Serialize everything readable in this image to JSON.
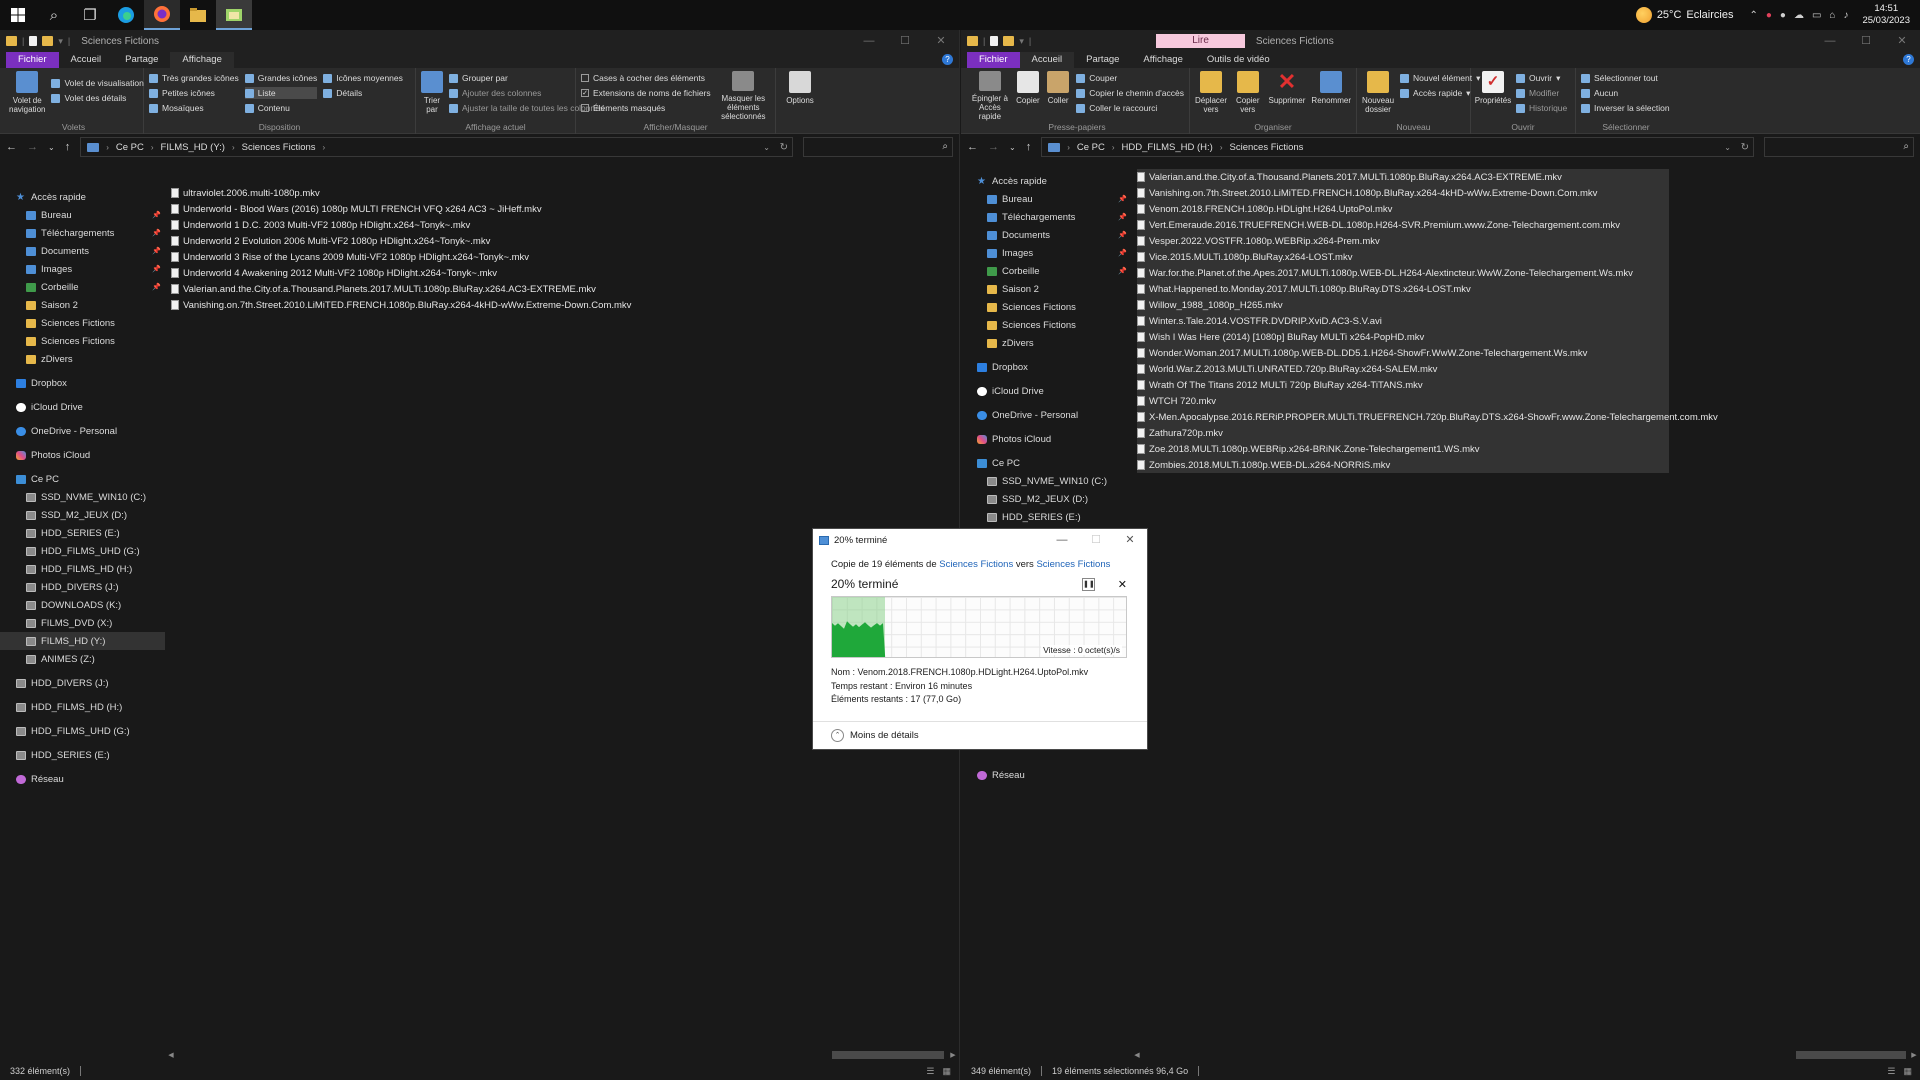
{
  "taskbar": {
    "weather_temp": "25°C",
    "weather_text": "Eclaircies",
    "time": "14:51",
    "date": "25/03/2023"
  },
  "left": {
    "title": "Sciences Fictions",
    "tabs": [
      "Fichier",
      "Accueil",
      "Partage",
      "Affichage"
    ],
    "ribbon": {
      "volets": {
        "label": "Volets",
        "nav_pane": "Volet de navigation",
        "preview": "Volet de visualisation",
        "details": "Volet des détails"
      },
      "disposition": {
        "label": "Disposition",
        "items": [
          "Très grandes icônes",
          "Grandes icônes",
          "Icônes moyennes",
          "Petites icônes",
          "Liste",
          "Détails",
          "Mosaïques",
          "Contenu"
        ]
      },
      "affichage_actuel": {
        "label": "Affichage actuel",
        "sort": "Trier par",
        "group": "Grouper par",
        "add_cols": "Ajouter des colonnes",
        "fit_cols": "Ajuster la taille de toutes les colonnes"
      },
      "afficher": {
        "label": "Afficher/Masquer",
        "checkboxes": "Cases à cocher des éléments",
        "extensions": "Extensions de noms de fichiers",
        "hidden": "Éléments masqués",
        "hide_selected": "Masquer les éléments sélectionnés"
      },
      "options": "Options"
    },
    "breadcrumb": [
      "Ce PC",
      "FILMS_HD (Y:)",
      "Sciences Fictions"
    ],
    "nav": [
      {
        "label": "Accès rapide",
        "type": "star",
        "indent": 0
      },
      {
        "label": "Bureau",
        "type": "folder-blue",
        "indent": 1,
        "pin": true
      },
      {
        "label": "Téléchargements",
        "type": "folder-blue",
        "indent": 1,
        "pin": true
      },
      {
        "label": "Documents",
        "type": "folder-blue",
        "indent": 1,
        "pin": true
      },
      {
        "label": "Images",
        "type": "folder-blue",
        "indent": 1,
        "pin": true
      },
      {
        "label": "Corbeille",
        "type": "green",
        "indent": 1,
        "pin": true
      },
      {
        "label": "Saison 2",
        "type": "folder",
        "indent": 1
      },
      {
        "label": "Sciences Fictions",
        "type": "folder",
        "indent": 1
      },
      {
        "label": "Sciences Fictions",
        "type": "folder",
        "indent": 1
      },
      {
        "label": "zDivers",
        "type": "folder",
        "indent": 1
      },
      {
        "label": "Dropbox",
        "type": "dropbox",
        "indent": 0,
        "gap": true
      },
      {
        "label": "iCloud Drive",
        "type": "cloud",
        "indent": 0,
        "gap": true
      },
      {
        "label": "OneDrive - Personal",
        "type": "onedrive",
        "indent": 0,
        "gap": true
      },
      {
        "label": "Photos iCloud",
        "type": "photos",
        "indent": 0,
        "gap": true
      },
      {
        "label": "Ce PC",
        "type": "pc",
        "indent": 0,
        "gap": true
      },
      {
        "label": "SSD_NVME_WIN10 (C:)",
        "type": "drive",
        "indent": 1
      },
      {
        "label": "SSD_M2_JEUX (D:)",
        "type": "drive",
        "indent": 1
      },
      {
        "label": "HDD_SERIES (E:)",
        "type": "drive",
        "indent": 1
      },
      {
        "label": "HDD_FILMS_UHD (G:)",
        "type": "drive",
        "indent": 1
      },
      {
        "label": "HDD_FILMS_HD (H:)",
        "type": "drive",
        "indent": 1
      },
      {
        "label": "HDD_DIVERS (J:)",
        "type": "drive",
        "indent": 1
      },
      {
        "label": "DOWNLOADS (K:)",
        "type": "drive",
        "indent": 1
      },
      {
        "label": "FILMS_DVD (X:)",
        "type": "drive",
        "indent": 1
      },
      {
        "label": "FILMS_HD (Y:)",
        "type": "drive",
        "indent": 1,
        "sel": true
      },
      {
        "label": "ANIMES (Z:)",
        "type": "drive",
        "indent": 1
      },
      {
        "label": "HDD_DIVERS (J:)",
        "type": "drive",
        "indent": 0,
        "gap": true
      },
      {
        "label": "HDD_FILMS_HD (H:)",
        "type": "drive",
        "indent": 0,
        "gap": true
      },
      {
        "label": "HDD_FILMS_UHD (G:)",
        "type": "drive",
        "indent": 0,
        "gap": true
      },
      {
        "label": "HDD_SERIES (E:)",
        "type": "drive",
        "indent": 0,
        "gap": true
      },
      {
        "label": "Réseau",
        "type": "net",
        "indent": 0,
        "gap": true
      }
    ],
    "files": [
      "ultraviolet.2006.multi-1080p.mkv",
      "Underworld - Blood Wars (2016) 1080p MULTI FRENCH VFQ x264 AC3 ~ JiHeff.mkv",
      "Underworld 1 D.C. 2003 Multi-VF2 1080p HDlight.x264~Tonyk~.mkv",
      "Underworld 2 Evolution 2006 Multi-VF2 1080p HDlight.x264~Tonyk~.mkv",
      "Underworld 3 Rise of the Lycans 2009 Multi-VF2 1080p HDlight.x264~Tonyk~.mkv",
      "Underworld 4 Awakening 2012 Multi-VF2 1080p HDlight.x264~Tonyk~.mkv",
      "Valerian.and.the.City.of.a.Thousand.Planets.2017.MULTi.1080p.BluRay.x264.AC3-EXTREME.mkv",
      "Vanishing.on.7th.Street.2010.LiMiTED.FRENCH.1080p.BluRay.x264-4kHD-wWw.Extreme-Down.Com.mkv"
    ],
    "status": "332 élément(s)"
  },
  "right": {
    "title": "Sciences Fictions",
    "context_tab": "Lire",
    "tabs": [
      "Fichier",
      "Accueil",
      "Partage",
      "Affichage",
      "Outils de vidéo"
    ],
    "ribbon": {
      "presse": {
        "label": "Presse-papiers",
        "pin": "Épingler à Accès rapide",
        "copy": "Copier",
        "paste": "Coller",
        "cut": "Couper",
        "copy_path": "Copier le chemin d'accès",
        "paste_shortcut": "Coller le raccourci"
      },
      "organiser": {
        "label": "Organiser",
        "move": "Déplacer vers",
        "copy_to": "Copier vers",
        "delete": "Supprimer",
        "rename": "Renommer"
      },
      "nouveau": {
        "label": "Nouveau",
        "new_folder": "Nouveau dossier",
        "new_item": "Nouvel élément",
        "easy_access": "Accès rapide"
      },
      "ouvrir": {
        "label": "Ouvrir",
        "properties": "Propriétés",
        "open": "Ouvrir",
        "edit": "Modifier",
        "history": "Historique"
      },
      "selectionner": {
        "label": "Sélectionner",
        "all": "Sélectionner tout",
        "none": "Aucun",
        "invert": "Inverser la sélection"
      }
    },
    "breadcrumb": [
      "Ce PC",
      "HDD_FILMS_HD (H:)",
      "Sciences Fictions"
    ],
    "nav": [
      {
        "label": "Accès rapide",
        "type": "star",
        "indent": 0
      },
      {
        "label": "Bureau",
        "type": "folder-blue",
        "indent": 1,
        "pin": true
      },
      {
        "label": "Téléchargements",
        "type": "folder-blue",
        "indent": 1,
        "pin": true
      },
      {
        "label": "Documents",
        "type": "folder-blue",
        "indent": 1,
        "pin": true
      },
      {
        "label": "Images",
        "type": "folder-blue",
        "indent": 1,
        "pin": true
      },
      {
        "label": "Corbeille",
        "type": "green",
        "indent": 1,
        "pin": true
      },
      {
        "label": "Saison 2",
        "type": "folder",
        "indent": 1
      },
      {
        "label": "Sciences Fictions",
        "type": "folder",
        "indent": 1
      },
      {
        "label": "Sciences Fictions",
        "type": "folder",
        "indent": 1
      },
      {
        "label": "zDivers",
        "type": "folder",
        "indent": 1
      },
      {
        "label": "Dropbox",
        "type": "dropbox",
        "indent": 0,
        "gap": true
      },
      {
        "label": "iCloud Drive",
        "type": "cloud",
        "indent": 0,
        "gap": true
      },
      {
        "label": "OneDrive - Personal",
        "type": "onedrive",
        "indent": 0,
        "gap": true
      },
      {
        "label": "Photos iCloud",
        "type": "photos",
        "indent": 0,
        "gap": true
      },
      {
        "label": "Ce PC",
        "type": "pc",
        "indent": 0,
        "gap": true
      },
      {
        "label": "SSD_NVME_WIN10 (C:)",
        "type": "drive",
        "indent": 1
      },
      {
        "label": "SSD_M2_JEUX (D:)",
        "type": "drive",
        "indent": 1
      },
      {
        "label": "HDD_SERIES (E:)",
        "type": "drive",
        "indent": 1
      }
    ],
    "nav_bottom": {
      "label": "Réseau",
      "type": "net"
    },
    "files": [
      "Valerian.and.the.City.of.a.Thousand.Planets.2017.MULTi.1080p.BluRay.x264.AC3-EXTREME.mkv",
      "Vanishing.on.7th.Street.2010.LiMiTED.FRENCH.1080p.BluRay.x264-4kHD-wWw.Extreme-Down.Com.mkv",
      "Venom.2018.FRENCH.1080p.HDLight.H264.UptoPol.mkv",
      "Vert.Emeraude.2016.TRUEFRENCH.WEB-DL.1080p.H264-SVR.Premium.www.Zone-Telechargement.com.mkv",
      "Vesper.2022.VOSTFR.1080p.WEBRip.x264-Prem.mkv",
      "Vice.2015.MULTi.1080p.BluRay.x264-LOST.mkv",
      "War.for.the.Planet.of.the.Apes.2017.MULTi.1080p.WEB-DL.H264-Alextincteur.WwW.Zone-Telechargement.Ws.mkv",
      "What.Happened.to.Monday.2017.MULTi.1080p.BluRay.DTS.x264-LOST.mkv",
      "Willow_1988_1080p_H265.mkv",
      "Winter.s.Tale.2014.VOSTFR.DVDRIP.XviD.AC3-S.V.avi",
      "Wish I Was Here (2014) [1080p] BluRay MULTi x264-PopHD.mkv",
      "Wonder.Woman.2017.MULTi.1080p.WEB-DL.DD5.1.H264-ShowFr.WwW.Zone-Telechargement.Ws.mkv",
      "World.War.Z.2013.MULTi.UNRATED.720p.BluRay.x264-SALEM.mkv",
      "Wrath Of The Titans 2012 MULTi 720p BluRay x264-TiTANS.mkv",
      "WTCH 720.mkv",
      "X-Men.Apocalypse.2016.RERiP.PROPER.MULTi.TRUEFRENCH.720p.BluRay.DTS.x264-ShowFr.www.Zone-Telechargement.com.mkv",
      "Zathura720p.mkv",
      "Zoe.2018.MULTi.1080p.WEBRip.x264-BRiNK.Zone-Telechargement1.WS.mkv",
      "Zombies.2018.MULTi.1080p.WEB-DL.x264-NORRiS.mkv"
    ],
    "status_count": "349 élément(s)",
    "status_selected": "19 éléments sélectionnés  96,4 Go"
  },
  "dialog": {
    "title": "20% terminé",
    "copy_prefix": "Copie de 19 éléments de",
    "source": "Sciences Fictions",
    "to": "vers",
    "dest": "Sciences Fictions",
    "percent_label": "20% terminé",
    "progress": 0.18,
    "speed": "Vitesse : 0 octet(s)/s",
    "name_line": "Nom : Venom.2018.FRENCH.1080p.HDLight.H264.UptoPol.mkv",
    "time_line": "Temps restant : Environ 16 minutes",
    "items_line": "Éléments restants : 17 (77,0 Go)",
    "less_details": "Moins de détails"
  }
}
